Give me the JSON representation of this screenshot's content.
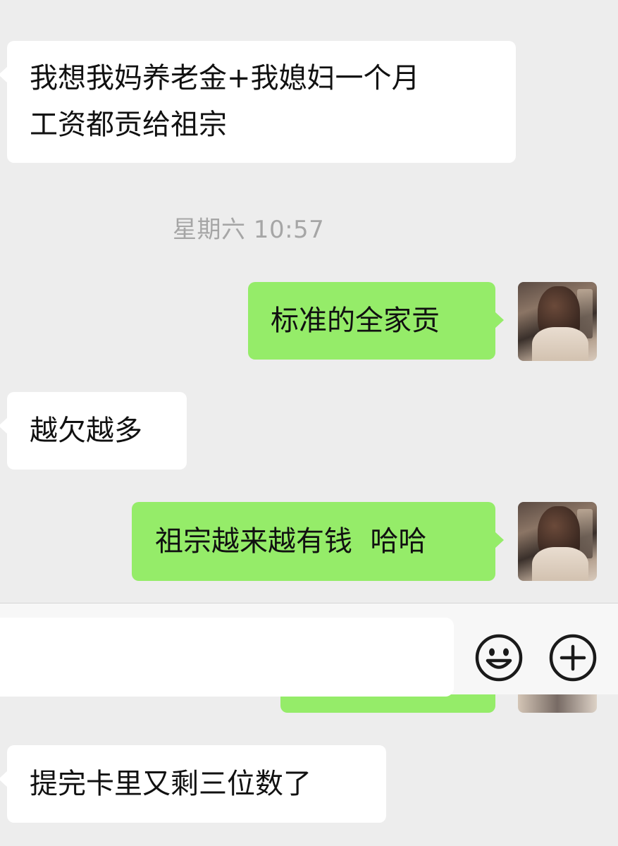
{
  "messages": [
    {
      "side": "in",
      "text_lines": [
        "我想我妈养老金+我媳妇一个月",
        "工资都贡给祖宗"
      ]
    },
    {
      "side": "out",
      "text": "标准的全家贡"
    },
    {
      "side": "in",
      "text": "越欠越多"
    },
    {
      "side": "out",
      "text": "祖宗越来越有钱  哈哈"
    },
    {
      "side": "in",
      "text": "提完卡里又剩三位数了"
    }
  ],
  "timestamp": "星期六 10:57",
  "input_bar": {
    "value": "",
    "emoji_icon": "smiley-face-icon",
    "plus_icon": "plus-circle-icon"
  },
  "colors": {
    "background": "#ededed",
    "incoming_bubble": "#ffffff",
    "outgoing_bubble": "#95ec69",
    "timestamp_text": "#a6a6a6"
  }
}
